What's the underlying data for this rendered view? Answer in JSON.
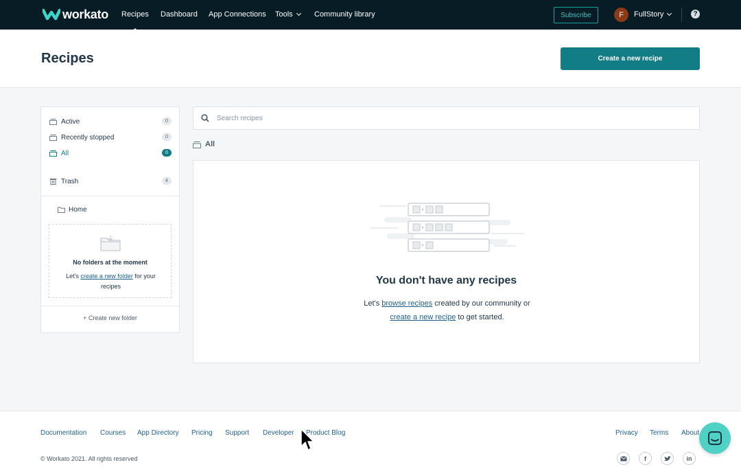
{
  "nav": {
    "logo_text": "workato",
    "items": [
      {
        "label": "Recipes",
        "active": true
      },
      {
        "label": "Dashboard"
      },
      {
        "label": "App Connections"
      },
      {
        "label": "Tools"
      },
      {
        "label": "Community library"
      }
    ],
    "subscribe_label": "Subscribe",
    "avatar_initial": "F",
    "user_name": "FullStory",
    "help_label": "?"
  },
  "header": {
    "title": "Recipes",
    "create_label": "Create a new recipe"
  },
  "sidebar": {
    "filters": [
      {
        "label": "Active",
        "count": "0"
      },
      {
        "label": "Recently stopped",
        "count": "0"
      },
      {
        "label": "All",
        "count": "0",
        "active": true
      }
    ],
    "trash": {
      "label": "Trash",
      "count": "4"
    },
    "home_label": "Home",
    "empty_folder": {
      "title": "No folders at the moment",
      "text_before": "Let's ",
      "link": "create a new folder",
      "text_after": " for your recipes"
    },
    "create_folder_label": "+ Create new folder"
  },
  "main": {
    "search_placeholder": "Search recipes",
    "section_label": "All",
    "empty": {
      "title": "You don't have any recipes",
      "text_1": "Let's ",
      "link_1": "browse recipes",
      "text_2": " created by our community or",
      "link_2": "create a new recipe",
      "text_3": " to get started."
    }
  },
  "footer": {
    "links": [
      "Documentation",
      "Courses",
      "App Directory",
      "Pricing",
      "Support",
      "Developer",
      "Product Blog"
    ],
    "right_links": [
      "Privacy",
      "Terms",
      "About"
    ],
    "copyright": "© Workato 2021. All rights reserved",
    "social_icons": [
      "mail-icon",
      "facebook-icon",
      "twitter-icon",
      "linkedin-icon"
    ]
  },
  "colors": {
    "nav_bg": "#071c24",
    "accent": "#137d86",
    "link": "#1f5f8b",
    "chat": "#4fd1c5"
  }
}
